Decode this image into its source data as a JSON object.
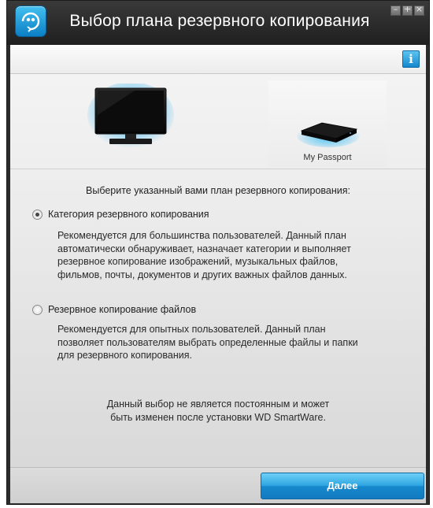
{
  "window": {
    "title": "Выбор плана резервного копирования",
    "controls": [
      "minimize-icon",
      "maximize-icon",
      "close-icon"
    ]
  },
  "toolbar": {
    "info_label": "i"
  },
  "devices": {
    "computer_icon": "monitor-icon",
    "drive_icon": "external-drive-icon",
    "drive_label": "My Passport"
  },
  "main": {
    "prompt": "Выберите указанный вами план резервного копирования:",
    "options": [
      {
        "label": "Категория резервного копирования",
        "selected": true,
        "description": [
          "Рекомендуется для большинства пользователей. Данный план",
          "автоматически обнаруживает, назначает категории и выполняет",
          "резервное копирование изображений, музыкальных файлов,",
          "фильмов, почты, документов и других важных файлов данных."
        ]
      },
      {
        "label": "Резервное копирование файлов",
        "selected": false,
        "description": [
          "Рекомендуется для опытных пользователей. Данный план",
          "позволяет пользователям выбрать определенные файлы и папки",
          "для резервного копирования."
        ]
      }
    ],
    "note": [
      "Данный выбор не является постоянным и может",
      "быть изменен после установки WD SmartWare."
    ]
  },
  "footer": {
    "next_label": "Далее"
  },
  "colors": {
    "accent": "#1f95d6",
    "titlebar": "#2a2a2a",
    "glow": "#2fb3f0"
  }
}
